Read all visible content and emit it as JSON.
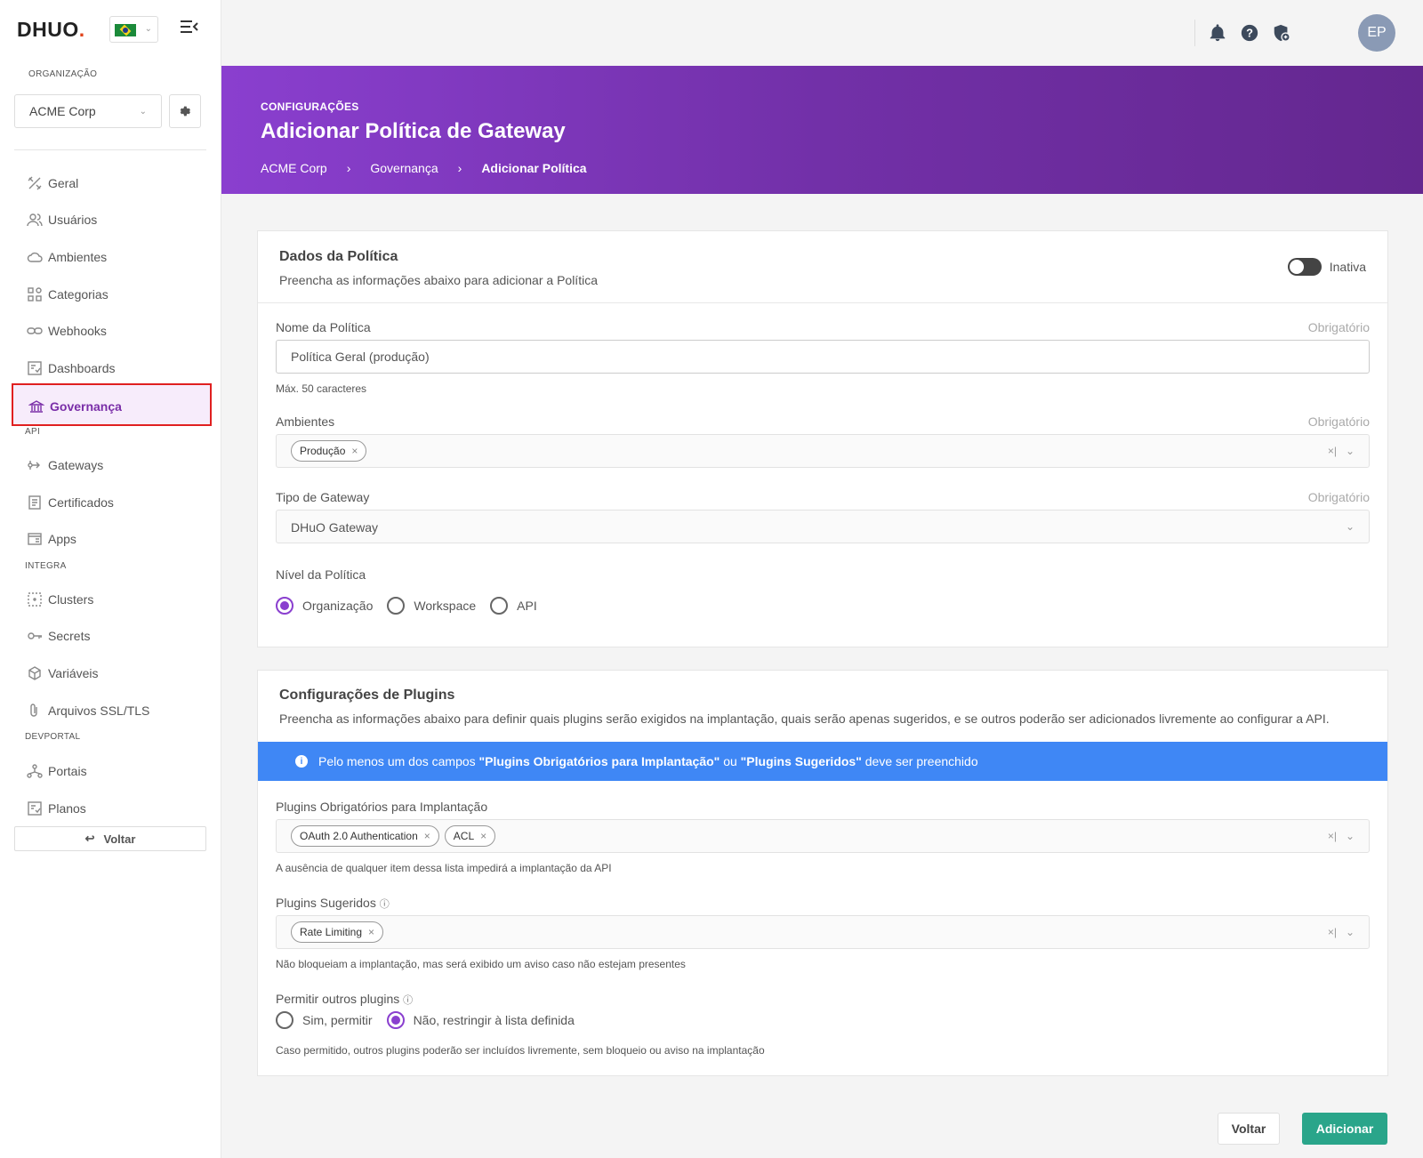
{
  "app": {
    "logo": "DHUO",
    "logo_dot": "."
  },
  "sidebar": {
    "org_section": "ORGANIZAÇÃO",
    "org_value": "ACME Corp",
    "items": [
      {
        "label": "Geral"
      },
      {
        "label": "Usuários"
      },
      {
        "label": "Ambientes"
      },
      {
        "label": "Categorias"
      },
      {
        "label": "Webhooks"
      },
      {
        "label": "Dashboards"
      },
      {
        "label": "Governança"
      }
    ],
    "api_section": "API",
    "api_items": [
      {
        "label": "Gateways"
      },
      {
        "label": "Certificados"
      },
      {
        "label": "Apps"
      }
    ],
    "integra_section": "INTEGRA",
    "integra_items": [
      {
        "label": "Clusters"
      },
      {
        "label": "Secrets"
      },
      {
        "label": "Variáveis"
      },
      {
        "label": "Arquivos SSL/TLS"
      }
    ],
    "devportal_section": "DEVPORTAL",
    "devportal_items": [
      {
        "label": "Portais"
      },
      {
        "label": "Planos"
      }
    ],
    "back_label": "Voltar"
  },
  "header": {
    "avatar": "EP"
  },
  "banner": {
    "superscript": "CONFIGURAÇÕES",
    "title": "Adicionar Política de Gateway",
    "breadcrumb": [
      "ACME Corp",
      "Governança",
      "Adicionar Política"
    ],
    "sep": "›"
  },
  "policy_card": {
    "title": "Dados da Política",
    "subtitle": "Preencha as informações abaixo para adicionar a Política",
    "toggle_label": "Inativa",
    "name_label": "Nome da Política",
    "required": "Obrigatório",
    "name_value": "Política Geral (produção)",
    "name_hint": "Máx. 50 caracteres",
    "env_label": "Ambientes",
    "env_tags": [
      "Produção"
    ],
    "gw_label": "Tipo de Gateway",
    "gw_value": "DHuO Gateway",
    "level_label": "Nível da Política",
    "level_options": [
      "Organização",
      "Workspace",
      "API"
    ],
    "level_selected": "Organização"
  },
  "plugins_card": {
    "title": "Configurações de Plugins",
    "subtitle": "Preencha as informações abaixo para definir quais plugins serão exigidos na implantação, quais serão apenas sugeridos, e se outros poderão ser adicionados livremente ao configurar a API.",
    "info_prefix": "Pelo menos um dos campos ",
    "info_field1": "\"Plugins Obrigatórios para Implantação\"",
    "info_mid": " ou ",
    "info_field2": "\"Plugins Sugeridos\"",
    "info_suffix": " deve ser preenchido",
    "required_label": "Plugins Obrigatórios para Implantação",
    "required_tags": [
      "OAuth 2.0 Authentication",
      "ACL"
    ],
    "required_hint": "A ausência de qualquer item dessa lista impedirá a implantação da API",
    "suggested_label": "Plugins Sugeridos",
    "suggested_tags": [
      "Rate Limiting"
    ],
    "suggested_hint": "Não bloqueiam a implantação, mas será exibido um aviso caso não estejam presentes",
    "allow_label": "Permitir outros plugins",
    "allow_options": [
      "Sim, permitir",
      "Não, restringir à lista definida"
    ],
    "allow_selected": "Não, restringir à lista definida",
    "allow_hint": "Caso permitido, outros plugins poderão ser incluídos livremente, sem bloqueio ou aviso na implantação"
  },
  "footer": {
    "back": "Voltar",
    "add": "Adicionar"
  },
  "colors": {
    "accent": "#8a3fcf",
    "banner_end": "#64278f",
    "info": "#3f87f5",
    "add_button": "#2aa58a",
    "highlight": "#e02020"
  }
}
